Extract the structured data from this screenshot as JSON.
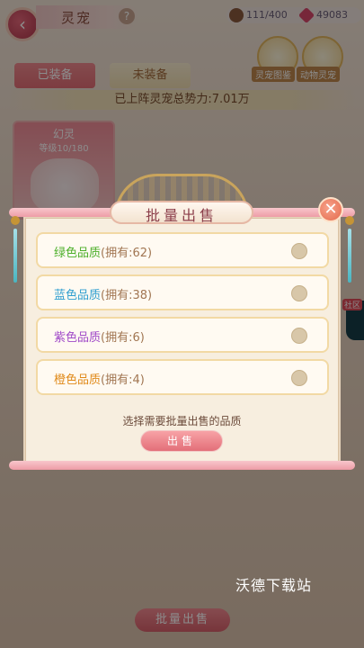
{
  "header": {
    "title": "灵宠",
    "help_glyph": "?",
    "back_glyph": "‹",
    "pet_count": "111/400",
    "gem_count": "49083",
    "side_buttons": [
      "灵宠图鉴",
      "动物灵宠"
    ]
  },
  "tabs": [
    {
      "label": "已装备",
      "active": true
    },
    {
      "label": "未装备",
      "active": false
    }
  ],
  "power_text": "已上阵灵宠总势力:7.01万",
  "pet_card": {
    "name": "幻灵",
    "level": "等级10/180"
  },
  "bottom_button": "批量出售",
  "social_label": "社区",
  "dialog": {
    "title": "批量出售",
    "close_glyph": "✕",
    "options": [
      {
        "quality": "绿色品质",
        "count": "(拥有:62)",
        "color": "#4caf2a"
      },
      {
        "quality": "蓝色品质",
        "count": "(拥有:38)",
        "color": "#2f9fd0"
      },
      {
        "quality": "紫色品质",
        "count": "(拥有:6)",
        "color": "#a04ac8"
      },
      {
        "quality": "橙色品质",
        "count": "(拥有:4)",
        "color": "#e08a1a"
      }
    ],
    "hint": "选择需要批量出售的品质",
    "sell_label": "出售"
  },
  "watermark": "沃德下载站"
}
